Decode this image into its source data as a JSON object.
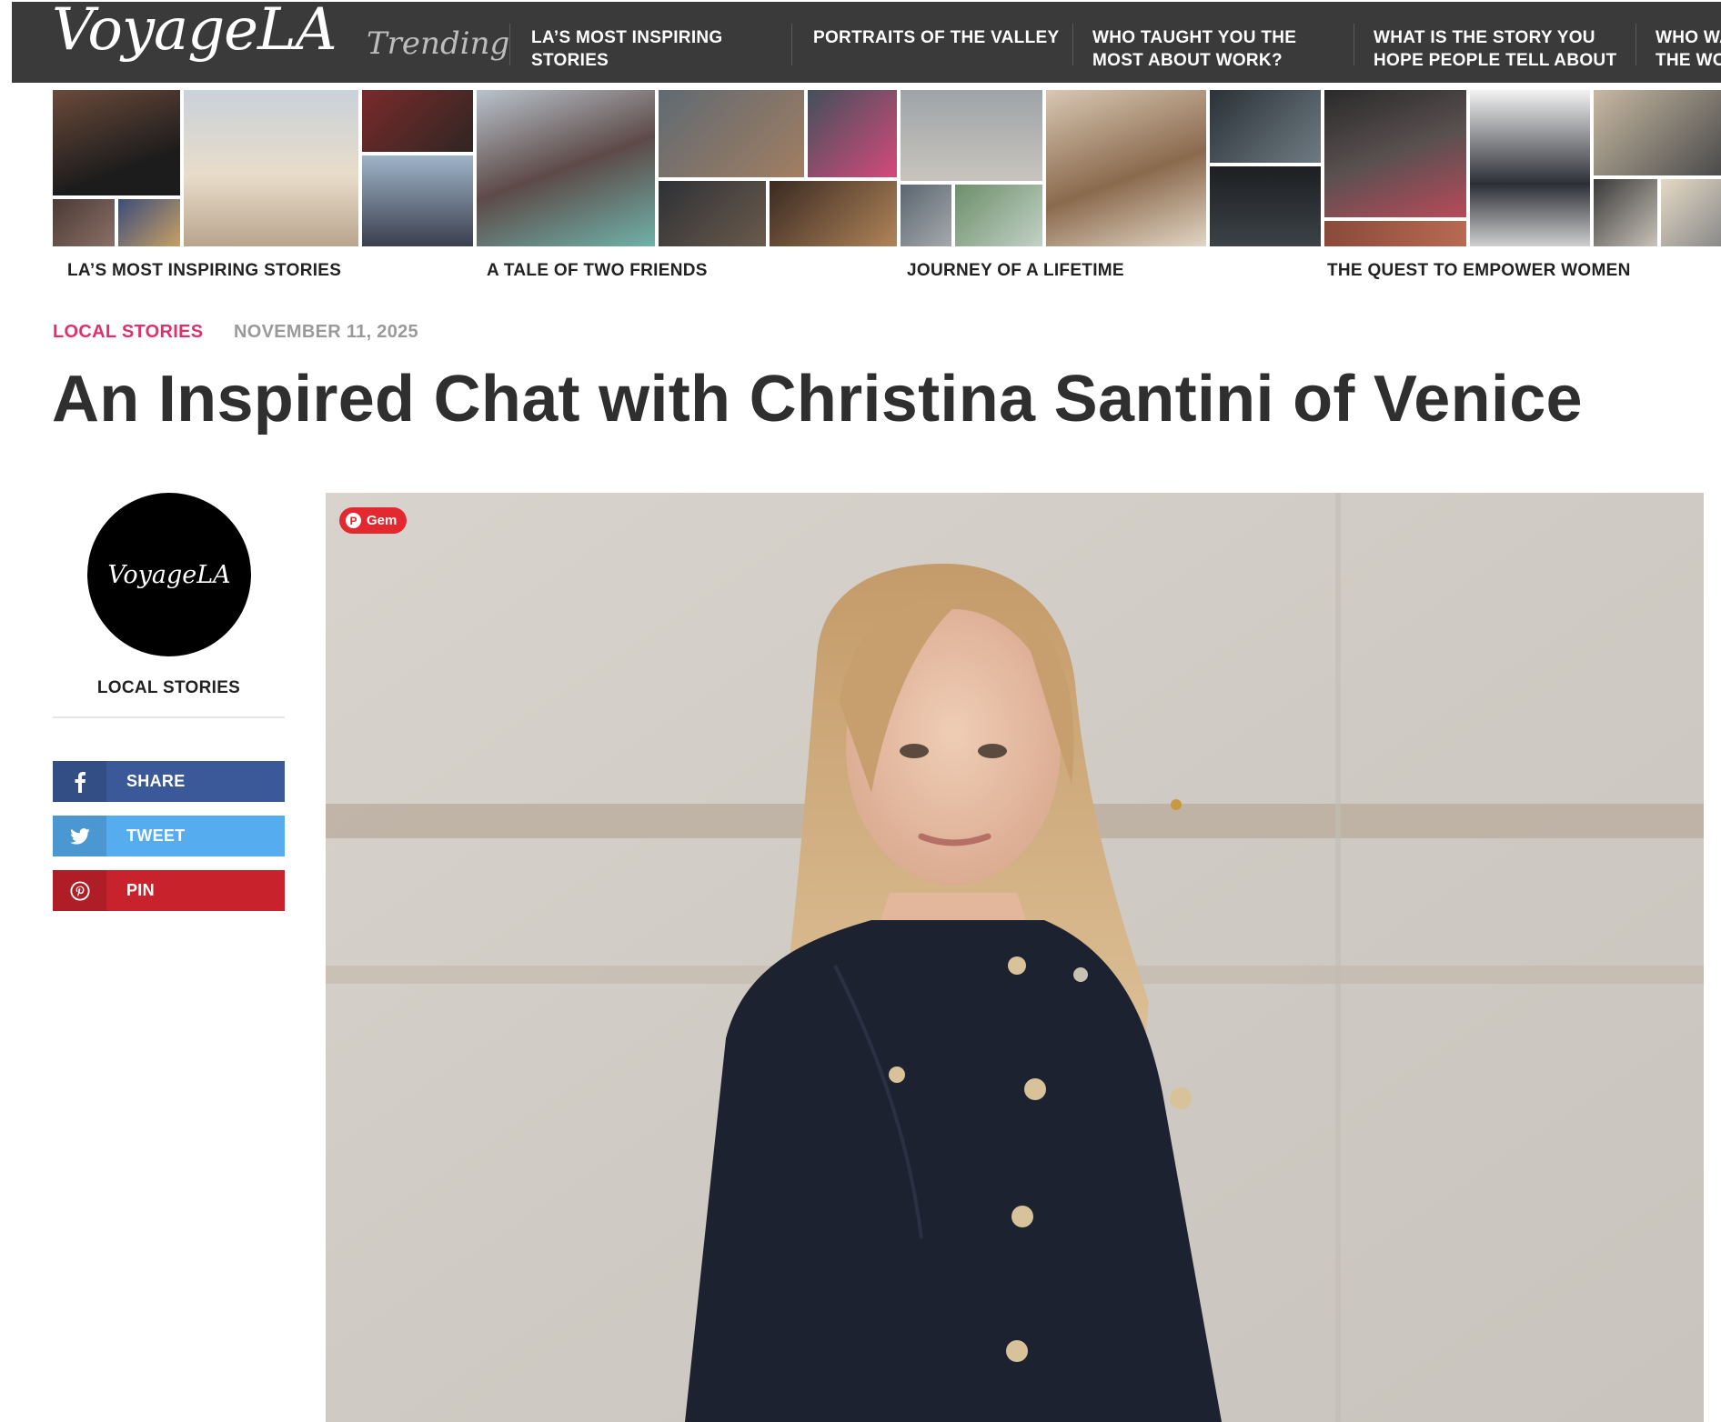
{
  "site": {
    "logo": "VoyageLA",
    "trending_label": "Trending"
  },
  "trending": [
    {
      "label": "LA’S MOST INSPIRING STORIES"
    },
    {
      "label": "PORTRAITS OF THE VALLEY"
    },
    {
      "label": "WHO TAUGHT YOU THE MOST ABOUT WORK?"
    },
    {
      "label": "WHAT IS THE STORY YOU HOPE PEOPLE TELL ABOUT"
    },
    {
      "label": "WHO WAS THE WORK"
    }
  ],
  "story_strip": [
    {
      "title": "LA’S MOST INSPIRING STORIES"
    },
    {
      "title": "A TALE OF TWO FRIENDS"
    },
    {
      "title": "JOURNEY OF A LIFETIME"
    },
    {
      "title": "THE QUEST TO EMPOWER WOMEN"
    }
  ],
  "article": {
    "category": "LOCAL STORIES",
    "date": "NOVEMBER 11, 2025",
    "title": "An Inspired Chat with Christina Santini of Venice"
  },
  "sidebar": {
    "avatar_text": "VoyageLA",
    "category": "LOCAL STORIES",
    "share": [
      {
        "label": "SHARE",
        "icon": "facebook-icon",
        "color": "#3b5998"
      },
      {
        "label": "TWEET",
        "icon": "twitter-icon",
        "color": "#55acee"
      },
      {
        "label": "PIN",
        "icon": "pinterest-icon",
        "color": "#c8232c"
      }
    ]
  },
  "hero": {
    "save_button": "Gem"
  }
}
